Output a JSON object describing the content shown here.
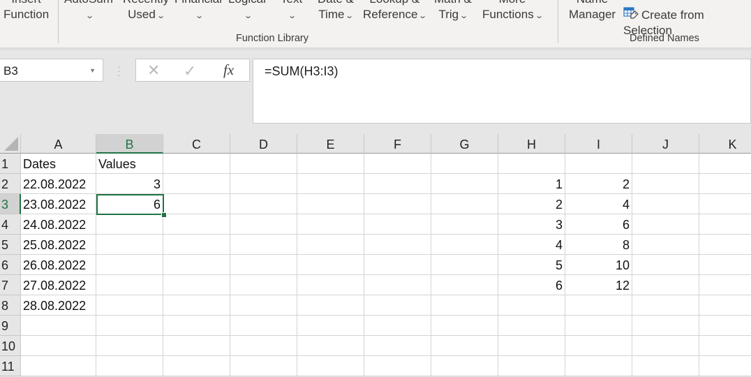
{
  "ribbon": {
    "groups": {
      "function_library": "Function Library",
      "defined_names": "Defined Names"
    },
    "buttons": {
      "insert_function": {
        "line1": "Insert",
        "line2": "Function"
      },
      "autosum": {
        "line1": "AutoSum",
        "line2": ""
      },
      "recently_used": {
        "line1": "Recently",
        "line2": "Used"
      },
      "financial": {
        "line1": "Financial",
        "line2": ""
      },
      "logical": {
        "line1": "Logical",
        "line2": ""
      },
      "text": {
        "line1": "Text",
        "line2": ""
      },
      "date_time": {
        "line1": "Date &",
        "line2": "Time"
      },
      "lookup_reference": {
        "line1": "Lookup &",
        "line2": "Reference"
      },
      "math_trig": {
        "line1": "Math &",
        "line2": "Trig"
      },
      "more_functions": {
        "line1": "More",
        "line2": "Functions"
      },
      "name_manager": {
        "line1": "Name",
        "line2": "Manager"
      },
      "create_from_selection": "Create from Selection"
    }
  },
  "formula_bar": {
    "name_box": "B3",
    "cancel_icon": "✕",
    "enter_icon": "✓",
    "fx_label": "fx",
    "formula": "=SUM(H3:I3)"
  },
  "sheet": {
    "columns": [
      "A",
      "B",
      "C",
      "D",
      "E",
      "F",
      "G",
      "H",
      "I",
      "J",
      "K"
    ],
    "selected_column": "B",
    "rows": [
      "1",
      "2",
      "3",
      "4",
      "5",
      "6",
      "7",
      "8",
      "9",
      "10",
      "11"
    ],
    "selected_row": "3",
    "active_cell": "B3",
    "cells": {
      "A1": "Dates",
      "B1": "Values",
      "A2": "22.08.2022",
      "B2": "3",
      "H2": "1",
      "I2": "2",
      "A3": "23.08.2022",
      "B3": "6",
      "H3": "2",
      "I3": "4",
      "A4": "24.08.2022",
      "H4": "3",
      "I4": "6",
      "A5": "25.08.2022",
      "H5": "4",
      "I5": "8",
      "A6": "26.08.2022",
      "H6": "5",
      "I6": "10",
      "A7": "27.08.2022",
      "H7": "6",
      "I7": "12",
      "A8": "28.08.2022"
    }
  },
  "colors": {
    "accent": "#217346"
  }
}
